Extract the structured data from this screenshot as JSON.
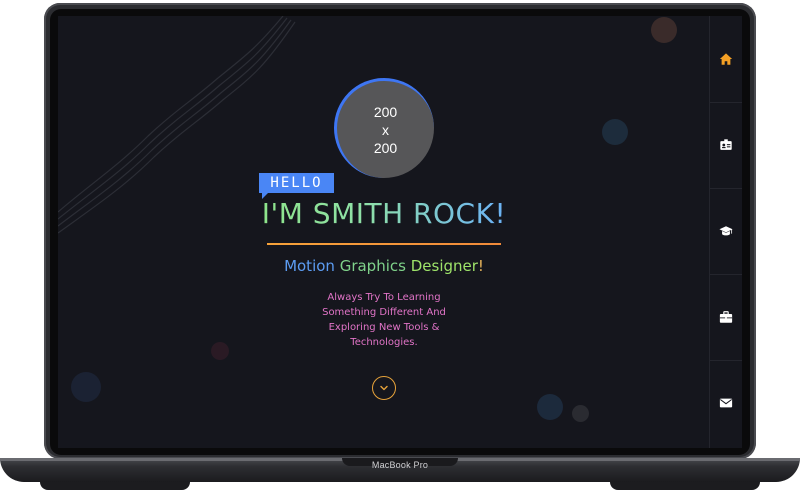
{
  "device": {
    "label": "MacBook Pro"
  },
  "hero": {
    "avatar_placeholder": {
      "line1": "200",
      "line2": "x",
      "line3": "200"
    },
    "greeting": "HELLO",
    "headline": "I'M SMITH ROCK!",
    "subtitle": {
      "part1": "Motion",
      "part2": "Graphics",
      "part3": "Designer",
      "part4": "!"
    },
    "tagline": "Always Try To Learning Something Different And Exploring New Tools & Technologies."
  },
  "scroll_button": {
    "icon": "chevron-down-icon"
  },
  "sidebar": {
    "items": [
      {
        "icon": "home-icon",
        "active": true
      },
      {
        "icon": "id-card-icon",
        "active": false
      },
      {
        "icon": "graduation-cap-icon",
        "active": false
      },
      {
        "icon": "briefcase-icon",
        "active": false
      },
      {
        "icon": "envelope-icon",
        "active": false
      }
    ]
  },
  "colors": {
    "background": "#15161d",
    "accent_orange": "#f4a025",
    "accent_blue": "#4a86f5",
    "headline_green": "#8ee87a",
    "tagline_pink": "#e174c7"
  }
}
